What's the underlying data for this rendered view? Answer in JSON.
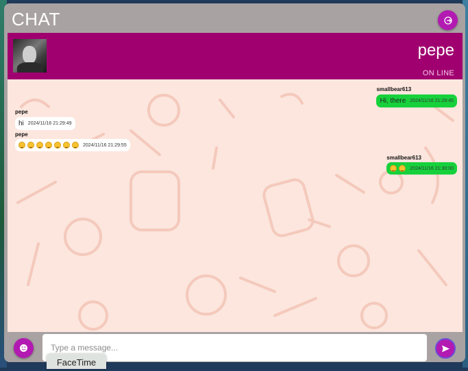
{
  "app": {
    "title": "CHAT"
  },
  "contact": {
    "name": "pepe",
    "status": "ON LINE"
  },
  "messages": [
    {
      "sender": "smallbear613",
      "text": "Hi, there",
      "time": "2024/11/16 21:29:45",
      "direction": "outgoing",
      "emojis": []
    },
    {
      "sender": "pepe",
      "text": "hi",
      "time": "2024/11/16 21:29:49",
      "direction": "incoming",
      "emojis": []
    },
    {
      "sender": "pepe",
      "text": "",
      "time": "2024/11/16 21:29:55",
      "direction": "incoming",
      "emojis": [
        "smile-emoji",
        "smile-emoji",
        "smile-emoji",
        "smile-emoji",
        "smile-emoji",
        "smile-emoji",
        "smile-emoji"
      ]
    },
    {
      "sender": "smallbear613",
      "text": "",
      "time": "2024/11/16 21:30:00",
      "direction": "outgoing",
      "emojis": [
        "smile-emoji",
        "smile-emoji"
      ]
    }
  ],
  "composer": {
    "placeholder": "Type a message...",
    "value": ""
  },
  "tooltip": {
    "text": "FaceTime"
  },
  "icons": {
    "logout": "logout-icon",
    "emoji": "emoji-icon",
    "send": "send-icon"
  },
  "colors": {
    "header": "#a0006f",
    "button": "#b21ab2",
    "outgoing_bubble": "#17d13c",
    "incoming_bubble": "#ffffff",
    "chat_background": "#fce6de"
  }
}
